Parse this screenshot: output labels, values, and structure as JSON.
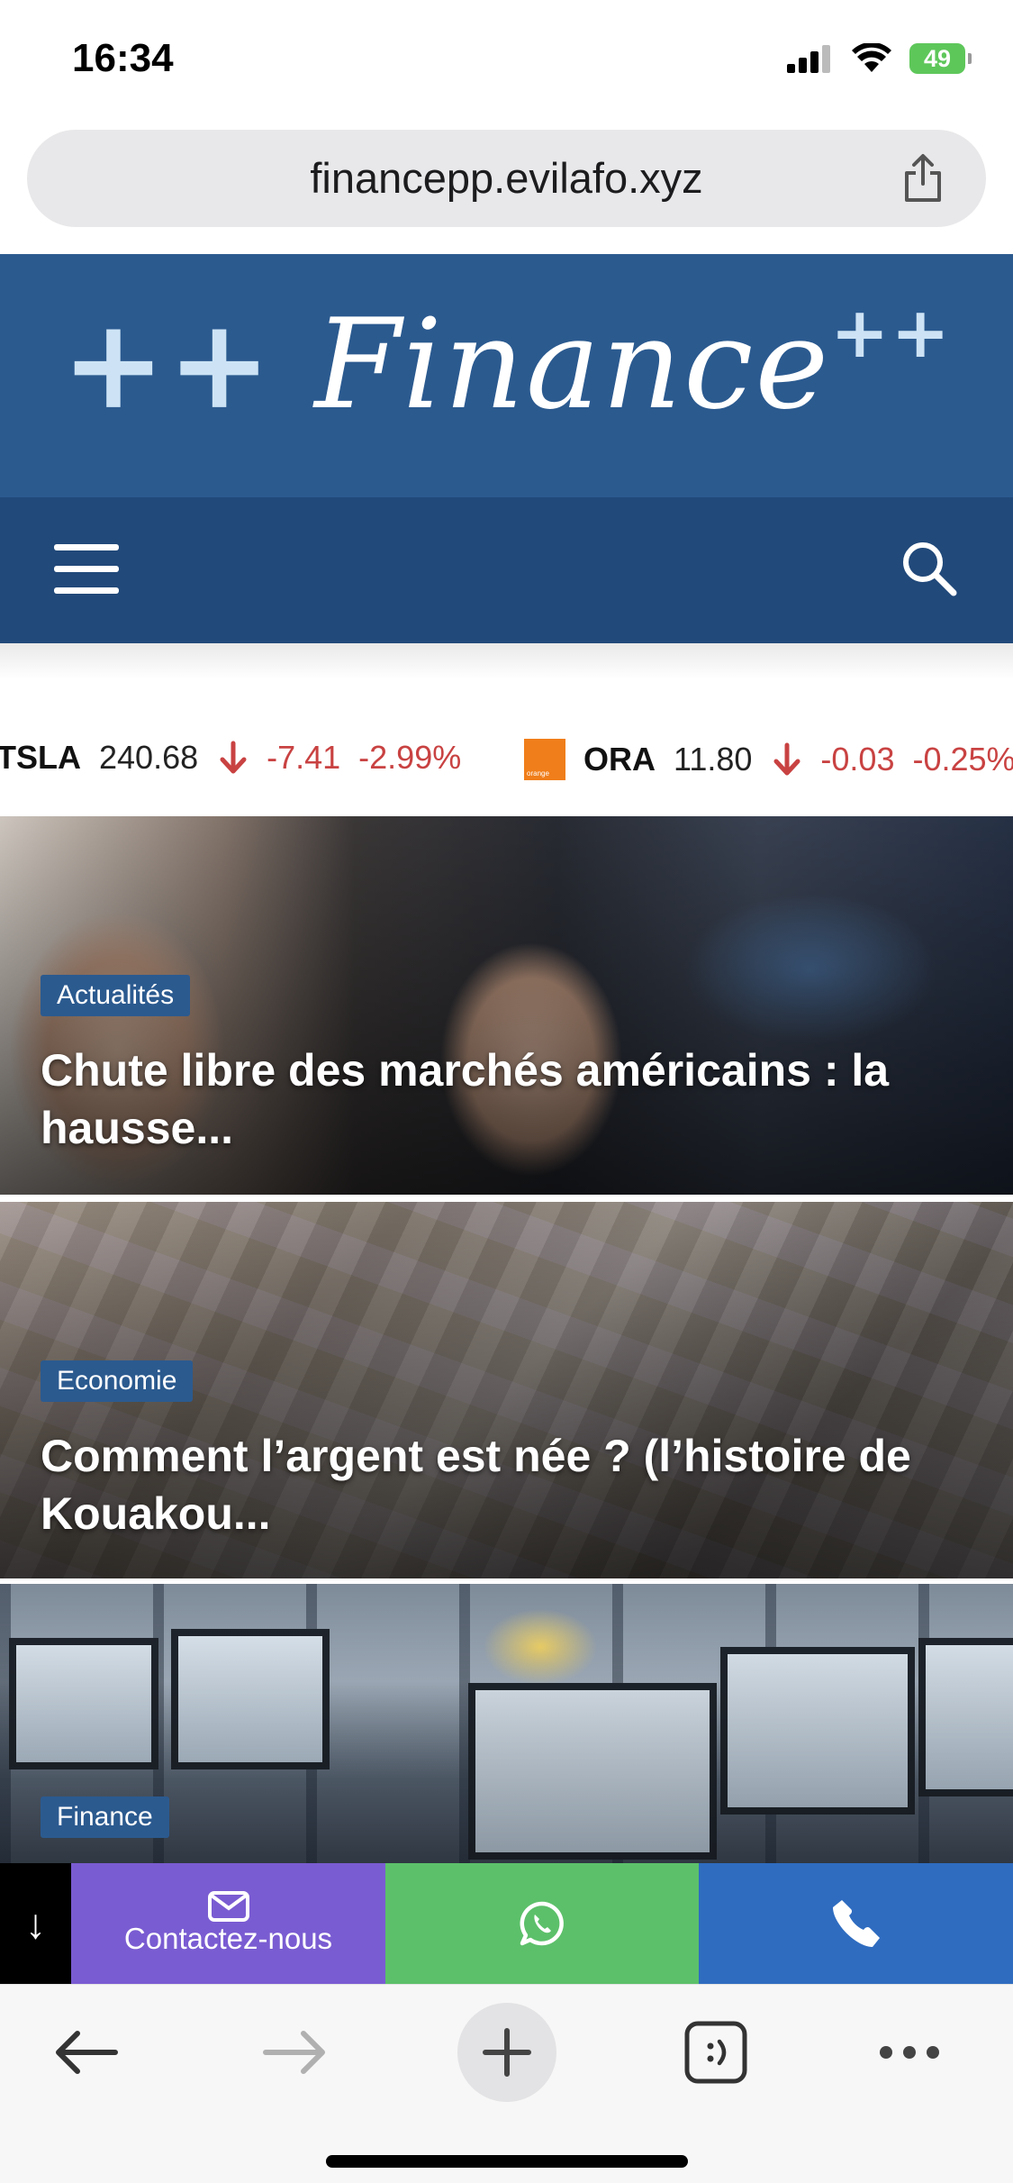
{
  "status_bar": {
    "time": "16:34",
    "battery_level": "49"
  },
  "browser": {
    "url": "financepp.evilafo.xyz",
    "icons": {
      "share": "share-icon",
      "back": "back-arrow-icon",
      "forward": "forward-arrow-icon",
      "new_tab": "plus-icon",
      "tabs": "tabs-icon",
      "more": "more-icon"
    }
  },
  "site": {
    "logo_prefix": "++",
    "logo_text": "Finance",
    "logo_suffix": "++",
    "brand_color": "#2b5a8f",
    "nav_color": "#21497a",
    "icons": {
      "menu": "hamburger-menu-icon",
      "search": "search-icon"
    }
  },
  "ticker": [
    {
      "symbol": "TSLA",
      "price": "240.68",
      "change": "-7.41",
      "percent": "-2.99%",
      "direction": "down"
    },
    {
      "symbol": "ORA",
      "logo_text": "orange",
      "price": "11.80",
      "change": "-0.03",
      "percent": "-0.25%",
      "direction": "down"
    }
  ],
  "articles": [
    {
      "category": "Actualités",
      "title_line1": "Chute libre des marchés américains : la",
      "title_line2": "hausse..."
    },
    {
      "category": "Economie",
      "title_line1": "Comment l’argent est née ? (l’histoire de",
      "title_line2": "Kouakou..."
    },
    {
      "category": "Finance"
    }
  ],
  "contact_bar": {
    "arrow": "↓",
    "email_label": "Contactez-nous",
    "colors": {
      "email": "#7a5cd2",
      "whatsapp": "#5cc06a",
      "phone": "#2f6cc0"
    }
  }
}
